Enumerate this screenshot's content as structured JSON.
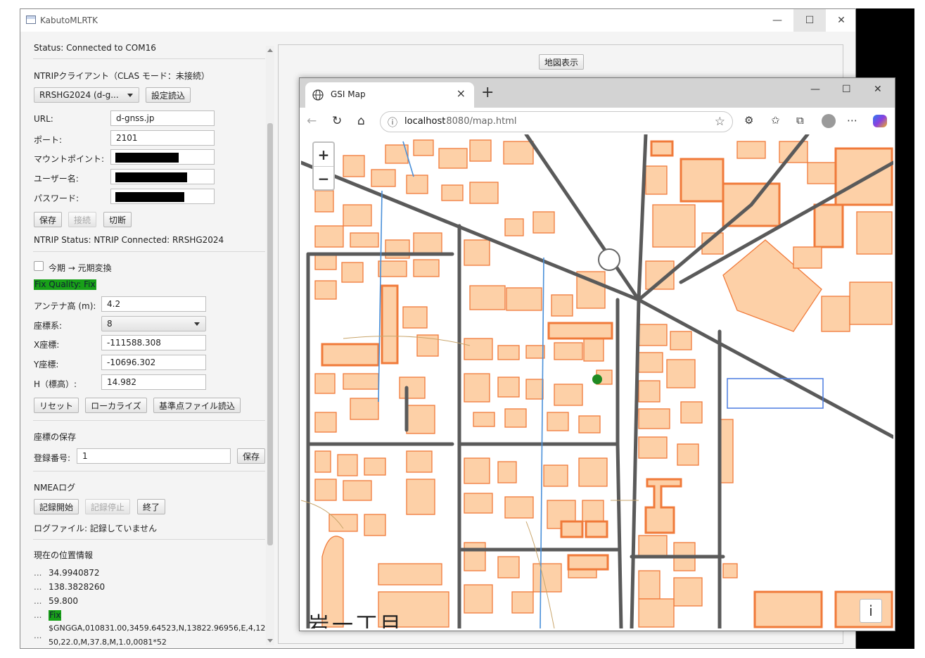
{
  "window": {
    "title": "KabutoMLRTK"
  },
  "status": {
    "text": "Status: Connected to COM16"
  },
  "ntrip": {
    "header": "NTRIPクライアント（CLAS モード：未接続）",
    "profile": "RRSHG2024 (d-g...",
    "load_settings": "設定読込",
    "url_label": "URL:",
    "url_value": "d-gnss.jp",
    "port_label": "ポート:",
    "port_value": "2101",
    "mount_label": "マウントポイント:",
    "user_label": "ユーザー名:",
    "pass_label": "パスワード:",
    "save": "保存",
    "connect": "接続",
    "disconnect": "切断",
    "status": "NTRIP Status: NTRIP Connected: RRSHG2024"
  },
  "coords": {
    "epoch_label": "今期 → 元期変換",
    "fix_quality": "Fix Quality: Fix",
    "antenna_label": "アンテナ高 (m):",
    "antenna_value": "4.2",
    "system_label": "座標系:",
    "system_value": "8",
    "x_label": "X座標:",
    "x_value": "-111588.308",
    "y_label": "Y座標:",
    "y_value": "-10696.302",
    "h_label": "H（標高）:",
    "h_value": "14.982",
    "reset": "リセット",
    "localize": "ローカライズ",
    "load_ref": "基準点ファイル読込"
  },
  "save_coords": {
    "header": "座標の保存",
    "reg_label": "登録番号:",
    "reg_value": "1",
    "save": "保存"
  },
  "nmea": {
    "header": "NMEAログ",
    "start": "記録開始",
    "stop": "記録停止",
    "end": "終了",
    "logfile": "ログファイル: 記録していません"
  },
  "position": {
    "header": "現在の位置情報",
    "lat": "34.9940872",
    "lon": "138.3828260",
    "alt": "59.800",
    "fix": "Fix",
    "gga1": "$GNGGA,010831.00,3459.64523,N,13822.96956,E,4,12,0.",
    "gga2": "50,22.0,M,37.8,M,1.0,0081*52",
    "dots": "..."
  },
  "right": {
    "map_button": "地図表示"
  },
  "browser": {
    "tab_title": "GSI Map",
    "url_host": "localhost",
    "url_rest": ":8080/map.html",
    "map_label": "岩一丁目",
    "zoom_in": "+",
    "zoom_out": "−",
    "info": "i"
  }
}
